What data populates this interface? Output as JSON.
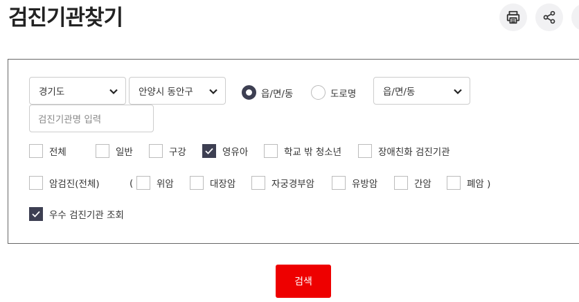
{
  "header": {
    "title": "검진기관찾기"
  },
  "toolbar": {
    "print_icon": "printer-icon",
    "share_icon": "share-icon"
  },
  "filters": {
    "province": "경기도",
    "district": "안양시 동안구",
    "address_type_options": [
      {
        "label": "읍/면/동",
        "selected": true
      },
      {
        "label": "도로명",
        "selected": false
      }
    ],
    "town": "읍/면/동",
    "name_placeholder": "검진기관명 입력"
  },
  "checkups": [
    {
      "label": "전체",
      "checked": false
    },
    {
      "label": "일반",
      "checked": false
    },
    {
      "label": "구강",
      "checked": false
    },
    {
      "label": "영유아",
      "checked": true
    },
    {
      "label": "학교 밖 청소년",
      "checked": false
    },
    {
      "label": "장애친화 검진기관",
      "checked": false
    }
  ],
  "cancer": {
    "all_label": "암검진(전체)",
    "open_paren": "(",
    "items": [
      {
        "label": "위암",
        "checked": false
      },
      {
        "label": "대장암",
        "checked": false
      },
      {
        "label": "자궁경부암",
        "checked": false
      },
      {
        "label": "유방암",
        "checked": false
      },
      {
        "label": "간암",
        "checked": false
      },
      {
        "label": "폐암 )",
        "checked": false
      }
    ]
  },
  "excellent": {
    "label": "우수 검진기관 조회",
    "checked": true
  },
  "submit_label": "검색",
  "colors": {
    "accent": "#ee0000",
    "checked": "#3d3f52"
  }
}
